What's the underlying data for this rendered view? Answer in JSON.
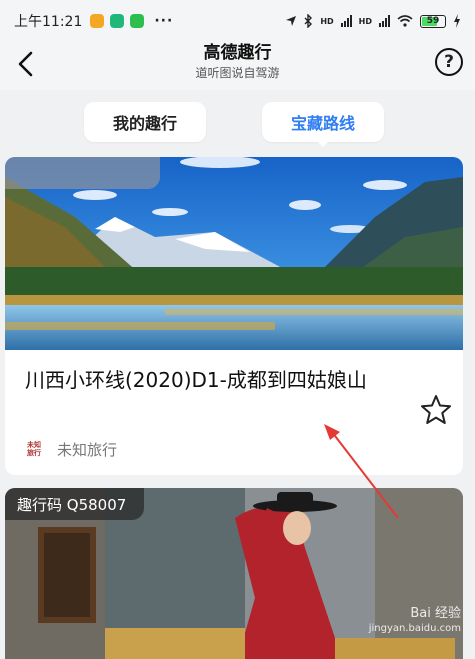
{
  "status_bar": {
    "time": "上午11:21",
    "app_colors": [
      "#f5a623",
      "#1db87a",
      "#2dbf4e"
    ],
    "more": "···",
    "signal_label_1": "HD",
    "signal_label_2": "HD",
    "battery": "59"
  },
  "header": {
    "back_icon": "chevron-left-icon",
    "title": "高德趣行",
    "subtitle": "道听图说自驾游",
    "help_label": "?"
  },
  "tabs": {
    "mine": "我的趣行",
    "treasure": "宝藏路线",
    "active": "treasure",
    "active_color": "#2f7ef2"
  },
  "cards": [
    {
      "code": "",
      "title": "川西小环线(2020)D1-成都到四姑娘山",
      "agency_logo": "未知旅行",
      "agency": "未知旅行",
      "favorite_icon": "star-outline-icon"
    },
    {
      "code": "趣行码 Q58007"
    }
  ],
  "watermark": {
    "line1": "Bai 经验",
    "line2": "jingyan.baidu.com"
  },
  "annotation": {
    "arrow_color": "#e53935"
  }
}
